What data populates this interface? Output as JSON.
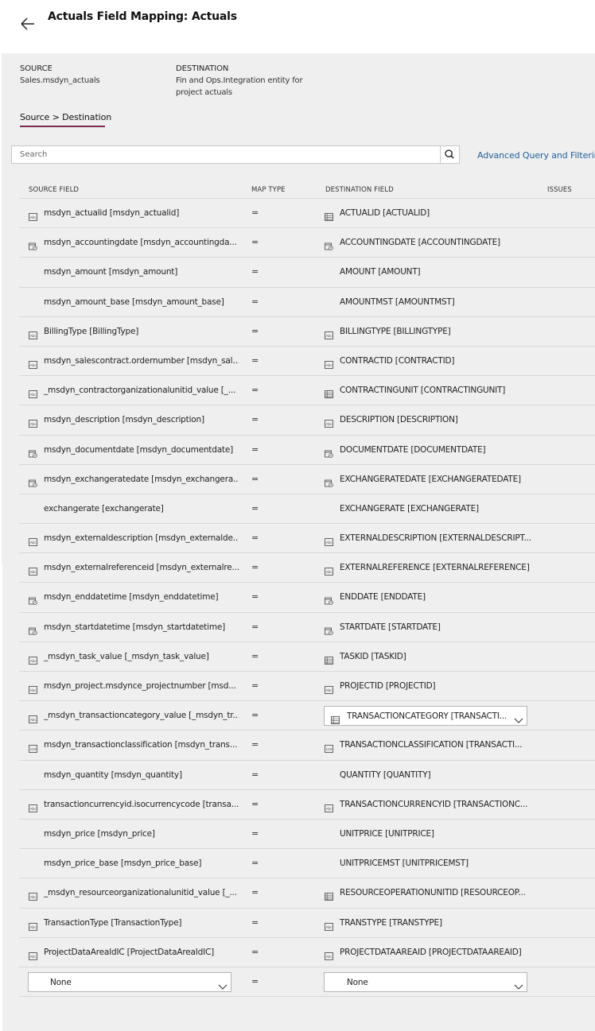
{
  "header": {
    "title": "Actuals Field Mapping: Actuals"
  },
  "meta": {
    "source_label": "SOURCE",
    "source_value": "Sales.msdyn_actuals",
    "dest_label": "DESTINATION",
    "dest_value_line1": "Fin and Ops.Integration entity for",
    "dest_value_line2": "project actuals"
  },
  "breadcrumb": "Source > Destination",
  "search": {
    "placeholder": "Search"
  },
  "advanced_link": "Advanced Query and Filtering",
  "columns": {
    "source": "SOURCE FIELD",
    "maptype": "MAP TYPE",
    "dest": "DESTINATION FIELD",
    "issues": "ISSUES"
  },
  "rows": [
    {
      "src": "msdyn_actualid [msdyn_actualid]",
      "src_icon": "text-icon",
      "map": "=",
      "dst": "ACTUALID [ACTUALID]",
      "dst_icon": "list-icon"
    },
    {
      "src": "msdyn_accountingdate [msdyn_accountingda...",
      "src_icon": "date-icon",
      "map": "=",
      "dst": "ACCOUNTINGDATE [ACCOUNTINGDATE]",
      "dst_icon": "date-icon"
    },
    {
      "src": "msdyn_amount [msdyn_amount]",
      "src_icon": "",
      "map": "=",
      "dst": "AMOUNT [AMOUNT]",
      "dst_icon": ""
    },
    {
      "src": "msdyn_amount_base [msdyn_amount_base]",
      "src_icon": "",
      "map": "=",
      "dst": "AMOUNTMST [AMOUNTMST]",
      "dst_icon": ""
    },
    {
      "src": "BillingType [BillingType]",
      "src_icon": "text-icon",
      "map": "=",
      "dst": "BILLINGTYPE [BILLINGTYPE]",
      "dst_icon": "text-icon"
    },
    {
      "src": "msdyn_salescontract.ordernumber [msdyn_sal...",
      "src_icon": "text-icon",
      "map": "=",
      "dst": "CONTRACTID [CONTRACTID]",
      "dst_icon": "text-icon"
    },
    {
      "src": "_msdyn_contractorganizationalunitid_value [_...",
      "src_icon": "text-icon",
      "map": "=",
      "dst": "CONTRACTINGUNIT [CONTRACTINGUNIT]",
      "dst_icon": "list-icon"
    },
    {
      "src": "msdyn_description [msdyn_description]",
      "src_icon": "text-icon",
      "map": "=",
      "dst": "DESCRIPTION [DESCRIPTION]",
      "dst_icon": "text-icon"
    },
    {
      "src": "msdyn_documentdate [msdyn_documentdate]",
      "src_icon": "date-icon",
      "map": "=",
      "dst": "DOCUMENTDATE [DOCUMENTDATE]",
      "dst_icon": "date-icon"
    },
    {
      "src": "msdyn_exchangeratedate [msdyn_exchangera...",
      "src_icon": "date-icon",
      "map": "=",
      "dst": "EXCHANGERATEDATE [EXCHANGERATEDATE]",
      "dst_icon": "date-icon"
    },
    {
      "src": "exchangerate [exchangerate]",
      "src_icon": "",
      "map": "=",
      "dst": "EXCHANGERATE [EXCHANGERATE]",
      "dst_icon": ""
    },
    {
      "src": "msdyn_externaldescription [msdyn_externalde...",
      "src_icon": "text-icon",
      "map": "=",
      "dst": "EXTERNALDESCRIPTION [EXTERNALDESCRIPT...",
      "dst_icon": "text-icon"
    },
    {
      "src": "msdyn_externalreferenceid [msdyn_externalre...",
      "src_icon": "text-icon",
      "map": "=",
      "dst": "EXTERNALREFERENCE [EXTERNALREFERENCE]",
      "dst_icon": "text-icon"
    },
    {
      "src": "msdyn_enddatetime [msdyn_enddatetime]",
      "src_icon": "date-icon",
      "map": "=",
      "dst": "ENDDATE [ENDDATE]",
      "dst_icon": "date-icon"
    },
    {
      "src": "msdyn_startdatetime [msdyn_startdatetime]",
      "src_icon": "date-icon",
      "map": "=",
      "dst": "STARTDATE [STARTDATE]",
      "dst_icon": "date-icon"
    },
    {
      "src": "_msdyn_task_value [_msdyn_task_value]",
      "src_icon": "text-icon",
      "map": "=",
      "dst": "TASKID [TASKID]",
      "dst_icon": "list-icon"
    },
    {
      "src": "msdyn_project.msdynce_projectnumber [msd...",
      "src_icon": "text-icon",
      "map": "=",
      "dst": "PROJECTID [PROJECTID]",
      "dst_icon": "text-icon"
    },
    {
      "src": "_msdyn_transactioncategory_value [_msdyn_tr...",
      "src_icon": "text-icon",
      "map": "=",
      "dst": "TRANSACTIONCATEGORY [TRANSACTI...",
      "dst_icon": "list-icon",
      "dst_dropdown": true
    },
    {
      "src": "msdyn_transactionclassification [msdyn_trans...",
      "src_icon": "option-icon",
      "map": "=",
      "dst": "TRANSACTIONCLASSIFICATION [TRANSACTI...",
      "dst_icon": "option-icon"
    },
    {
      "src": "msdyn_quantity [msdyn_quantity]",
      "src_icon": "",
      "map": "=",
      "dst": "QUANTITY [QUANTITY]",
      "dst_icon": ""
    },
    {
      "src": "transactioncurrencyid.isocurrencycode [transa...",
      "src_icon": "text-icon",
      "map": "=",
      "dst": "TRANSACTIONCURRENCYID [TRANSACTIONC...",
      "dst_icon": "text-icon"
    },
    {
      "src": "msdyn_price [msdyn_price]",
      "src_icon": "",
      "map": "=",
      "dst": "UNITPRICE [UNITPRICE]",
      "dst_icon": ""
    },
    {
      "src": "msdyn_price_base [msdyn_price_base]",
      "src_icon": "",
      "map": "=",
      "dst": "UNITPRICEMST [UNITPRICEMST]",
      "dst_icon": ""
    },
    {
      "src": "_msdyn_resourceorganizationalunitid_value [_...",
      "src_icon": "text-icon",
      "map": "=",
      "dst": "RESOURCEOPERATIONUNITID [RESOURCEOP...",
      "dst_icon": "list-icon"
    },
    {
      "src": "TransactionType [TransactionType]",
      "src_icon": "text-icon",
      "map": "=",
      "dst": "TRANSTYPE [TRANSTYPE]",
      "dst_icon": "text-icon"
    },
    {
      "src": "ProjectDataAreaIdIC [ProjectDataAreaIdIC]",
      "src_icon": "text-icon",
      "map": "=",
      "dst": "PROJECTDATAAREAID [PROJECTDATAAREAID]",
      "dst_icon": "text-icon"
    }
  ],
  "new_row": {
    "src": "None",
    "map": "=",
    "dst": "None"
  }
}
